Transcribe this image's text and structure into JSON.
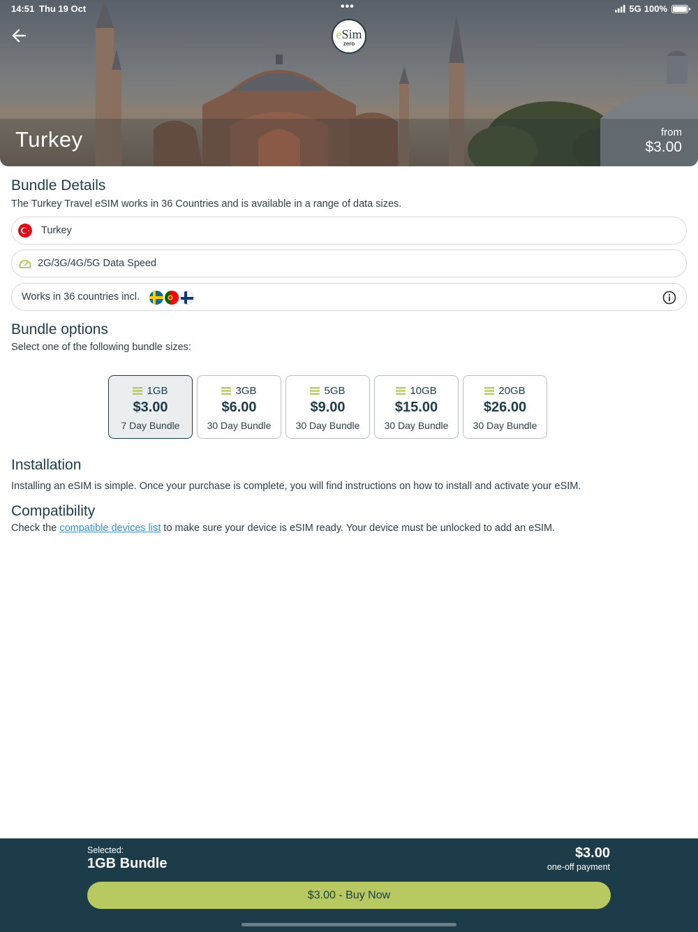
{
  "status_bar": {
    "time": "14:51",
    "date": "Thu 19 Oct",
    "network": "5G",
    "battery": "100%"
  },
  "hero": {
    "title": "Turkey",
    "from_label": "from",
    "from_price": "$3.00",
    "logo_text_e": "e",
    "logo_text_sim": "Sim",
    "logo_text_zero": "zero"
  },
  "bundle_details": {
    "title": "Bundle Details",
    "description": "The Turkey Travel eSIM works in 36 Countries and is available in a range of data sizes.",
    "country": "Turkey",
    "speed": "2G/3G/4G/5G Data Speed",
    "coverage": "Works in 36 countries incl."
  },
  "bundle_options": {
    "title": "Bundle options",
    "subtitle": "Select one of the following bundle sizes:",
    "items": [
      {
        "size": "1GB",
        "price": "$3.00",
        "duration": "7 Day Bundle",
        "selected": true
      },
      {
        "size": "3GB",
        "price": "$6.00",
        "duration": "30 Day Bundle",
        "selected": false
      },
      {
        "size": "5GB",
        "price": "$9.00",
        "duration": "30 Day Bundle",
        "selected": false
      },
      {
        "size": "10GB",
        "price": "$15.00",
        "duration": "30 Day Bundle",
        "selected": false
      },
      {
        "size": "20GB",
        "price": "$26.00",
        "duration": "30 Day Bundle",
        "selected": false
      }
    ]
  },
  "installation": {
    "title": "Installation",
    "text": "Installing an eSIM is simple. Once your purchase is complete, you will find instructions on how to install and activate your eSIM."
  },
  "compatibility": {
    "title": "Compatibility",
    "text_before": "Check the ",
    "link": "compatible devices list",
    "text_after": " to make sure your device is eSIM ready. Your device must be unlocked to add an eSIM."
  },
  "footer": {
    "selected_label": "Selected:",
    "selected_name": "1GB Bundle",
    "price": "$3.00",
    "payment_note": "one-off payment",
    "buy_label": "$3.00 - Buy Now"
  },
  "colors": {
    "primary": "#1d3c49",
    "accent": "#b7c960",
    "link": "#3a8fd0",
    "turkey_red": "#e30a17"
  }
}
